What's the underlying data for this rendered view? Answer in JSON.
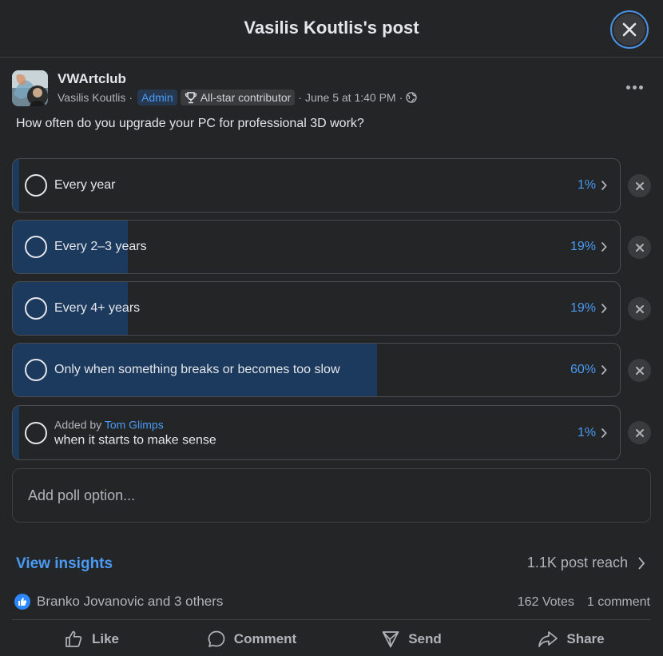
{
  "header": {
    "title": "Vasilis Koutlis's post"
  },
  "post": {
    "group_name": "VWArtclub",
    "author": "Vasilis Koutlis",
    "sep1": "·",
    "admin_badge": "Admin",
    "contributor_badge": "All-star contributor",
    "sep2": "·",
    "timestamp": "June 5 at 1:40 PM",
    "sep3": "·",
    "question": "How often do you upgrade your PC for professional 3D work?"
  },
  "poll": {
    "options": [
      {
        "label": "Every year",
        "percent_text": "1%",
        "percent": 1
      },
      {
        "label": "Every 2–3 years",
        "percent_text": "19%",
        "percent": 19
      },
      {
        "label": "Every 4+ years",
        "percent_text": "19%",
        "percent": 19
      },
      {
        "label": "Only when something breaks or becomes too slow",
        "percent_text": "60%",
        "percent": 60
      },
      {
        "label": "when it starts to make sense",
        "percent_text": "1%",
        "percent": 1,
        "added_by_prefix": "Added by",
        "added_by_name": "Tom Glimps"
      }
    ],
    "add_option_placeholder": "Add poll option..."
  },
  "insights": {
    "link": "View insights",
    "reach": "1.1K post reach"
  },
  "engagement": {
    "reactions": "Branko Jovanovic and 3 others",
    "votes": "162 Votes",
    "comments": "1 comment"
  },
  "actions": {
    "like": "Like",
    "comment": "Comment",
    "send": "Send",
    "share": "Share"
  },
  "colors": {
    "background": "#242526",
    "accent": "#4a9bf5",
    "bar_fill": "#1c3a5e",
    "like_blue": "#2d88ff"
  },
  "icons": [
    "close-icon",
    "more-icon",
    "trophy-icon",
    "globe-icon",
    "radio-icon",
    "chevron-right-icon",
    "remove-icon",
    "like-icon",
    "comment-icon",
    "send-icon",
    "share-icon"
  ]
}
